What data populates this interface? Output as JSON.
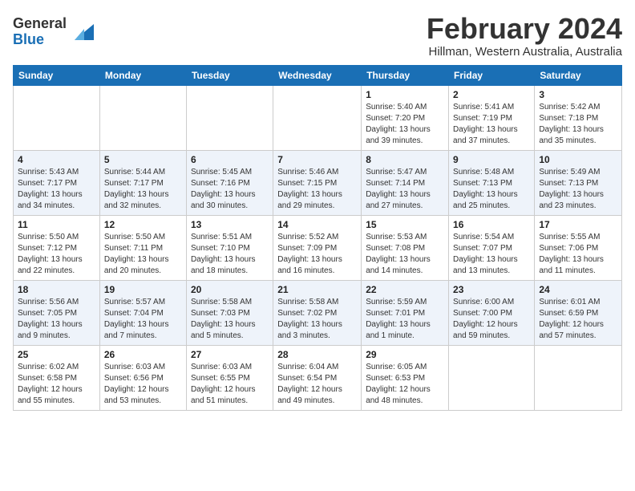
{
  "header": {
    "logo_line1": "General",
    "logo_line2": "Blue",
    "month": "February 2024",
    "location": "Hillman, Western Australia, Australia"
  },
  "weekdays": [
    "Sunday",
    "Monday",
    "Tuesday",
    "Wednesday",
    "Thursday",
    "Friday",
    "Saturday"
  ],
  "weeks": [
    [
      {
        "day": "",
        "info": ""
      },
      {
        "day": "",
        "info": ""
      },
      {
        "day": "",
        "info": ""
      },
      {
        "day": "",
        "info": ""
      },
      {
        "day": "1",
        "info": "Sunrise: 5:40 AM\nSunset: 7:20 PM\nDaylight: 13 hours\nand 39 minutes."
      },
      {
        "day": "2",
        "info": "Sunrise: 5:41 AM\nSunset: 7:19 PM\nDaylight: 13 hours\nand 37 minutes."
      },
      {
        "day": "3",
        "info": "Sunrise: 5:42 AM\nSunset: 7:18 PM\nDaylight: 13 hours\nand 35 minutes."
      }
    ],
    [
      {
        "day": "4",
        "info": "Sunrise: 5:43 AM\nSunset: 7:17 PM\nDaylight: 13 hours\nand 34 minutes."
      },
      {
        "day": "5",
        "info": "Sunrise: 5:44 AM\nSunset: 7:17 PM\nDaylight: 13 hours\nand 32 minutes."
      },
      {
        "day": "6",
        "info": "Sunrise: 5:45 AM\nSunset: 7:16 PM\nDaylight: 13 hours\nand 30 minutes."
      },
      {
        "day": "7",
        "info": "Sunrise: 5:46 AM\nSunset: 7:15 PM\nDaylight: 13 hours\nand 29 minutes."
      },
      {
        "day": "8",
        "info": "Sunrise: 5:47 AM\nSunset: 7:14 PM\nDaylight: 13 hours\nand 27 minutes."
      },
      {
        "day": "9",
        "info": "Sunrise: 5:48 AM\nSunset: 7:13 PM\nDaylight: 13 hours\nand 25 minutes."
      },
      {
        "day": "10",
        "info": "Sunrise: 5:49 AM\nSunset: 7:13 PM\nDaylight: 13 hours\nand 23 minutes."
      }
    ],
    [
      {
        "day": "11",
        "info": "Sunrise: 5:50 AM\nSunset: 7:12 PM\nDaylight: 13 hours\nand 22 minutes."
      },
      {
        "day": "12",
        "info": "Sunrise: 5:50 AM\nSunset: 7:11 PM\nDaylight: 13 hours\nand 20 minutes."
      },
      {
        "day": "13",
        "info": "Sunrise: 5:51 AM\nSunset: 7:10 PM\nDaylight: 13 hours\nand 18 minutes."
      },
      {
        "day": "14",
        "info": "Sunrise: 5:52 AM\nSunset: 7:09 PM\nDaylight: 13 hours\nand 16 minutes."
      },
      {
        "day": "15",
        "info": "Sunrise: 5:53 AM\nSunset: 7:08 PM\nDaylight: 13 hours\nand 14 minutes."
      },
      {
        "day": "16",
        "info": "Sunrise: 5:54 AM\nSunset: 7:07 PM\nDaylight: 13 hours\nand 13 minutes."
      },
      {
        "day": "17",
        "info": "Sunrise: 5:55 AM\nSunset: 7:06 PM\nDaylight: 13 hours\nand 11 minutes."
      }
    ],
    [
      {
        "day": "18",
        "info": "Sunrise: 5:56 AM\nSunset: 7:05 PM\nDaylight: 13 hours\nand 9 minutes."
      },
      {
        "day": "19",
        "info": "Sunrise: 5:57 AM\nSunset: 7:04 PM\nDaylight: 13 hours\nand 7 minutes."
      },
      {
        "day": "20",
        "info": "Sunrise: 5:58 AM\nSunset: 7:03 PM\nDaylight: 13 hours\nand 5 minutes."
      },
      {
        "day": "21",
        "info": "Sunrise: 5:58 AM\nSunset: 7:02 PM\nDaylight: 13 hours\nand 3 minutes."
      },
      {
        "day": "22",
        "info": "Sunrise: 5:59 AM\nSunset: 7:01 PM\nDaylight: 13 hours\nand 1 minute."
      },
      {
        "day": "23",
        "info": "Sunrise: 6:00 AM\nSunset: 7:00 PM\nDaylight: 12 hours\nand 59 minutes."
      },
      {
        "day": "24",
        "info": "Sunrise: 6:01 AM\nSunset: 6:59 PM\nDaylight: 12 hours\nand 57 minutes."
      }
    ],
    [
      {
        "day": "25",
        "info": "Sunrise: 6:02 AM\nSunset: 6:58 PM\nDaylight: 12 hours\nand 55 minutes."
      },
      {
        "day": "26",
        "info": "Sunrise: 6:03 AM\nSunset: 6:56 PM\nDaylight: 12 hours\nand 53 minutes."
      },
      {
        "day": "27",
        "info": "Sunrise: 6:03 AM\nSunset: 6:55 PM\nDaylight: 12 hours\nand 51 minutes."
      },
      {
        "day": "28",
        "info": "Sunrise: 6:04 AM\nSunset: 6:54 PM\nDaylight: 12 hours\nand 49 minutes."
      },
      {
        "day": "29",
        "info": "Sunrise: 6:05 AM\nSunset: 6:53 PM\nDaylight: 12 hours\nand 48 minutes."
      },
      {
        "day": "",
        "info": ""
      },
      {
        "day": "",
        "info": ""
      }
    ]
  ]
}
